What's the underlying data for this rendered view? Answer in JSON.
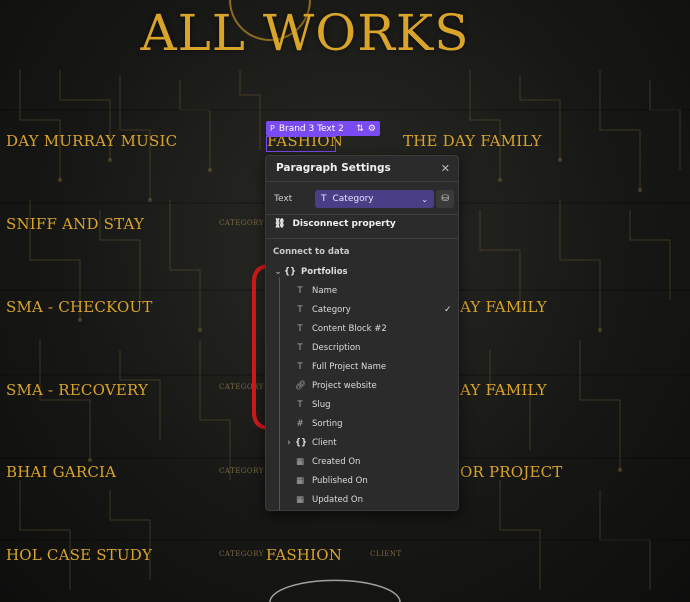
{
  "page": {
    "title": "All Works"
  },
  "works": [
    {
      "name": "Day Murray Music"
    },
    {
      "name": "Sniff and Stay"
    },
    {
      "name": "SMA - Checkout"
    },
    {
      "name": "SMA - Recovery"
    },
    {
      "name": "Bhai Garcia"
    },
    {
      "name": "HOL Case Study"
    }
  ],
  "col2": {
    "row1": "Fashion",
    "row6": "Fashion"
  },
  "col3": {
    "row1": "The Day Family",
    "row3": "ay Family",
    "row4": "ay Family",
    "row5": "or Project"
  },
  "tiny_labels": {
    "category": "CATEGORY",
    "client": "CLIENT"
  },
  "selection": {
    "type_badge": "P",
    "label": "Brand 3 Text 2"
  },
  "panel": {
    "title": "Paragraph Settings",
    "text_label": "Text",
    "binding_value": "Category",
    "disconnect_label": "Disconnect property",
    "section_label": "Connect to data",
    "tree": [
      {
        "label": "Portfolios",
        "icon": "braces-icon",
        "kind": "group"
      },
      {
        "label": "Name",
        "icon": "text-type-icon"
      },
      {
        "label": "Category",
        "icon": "text-type-icon",
        "checked": true
      },
      {
        "label": "Content Block #2",
        "icon": "text-type-icon"
      },
      {
        "label": "Description",
        "icon": "text-type-icon"
      },
      {
        "label": "Full Project Name",
        "icon": "text-type-icon"
      },
      {
        "label": "Project website",
        "icon": "link-icon"
      },
      {
        "label": "Slug",
        "icon": "text-type-icon"
      },
      {
        "label": "Sorting",
        "icon": "hash-icon"
      },
      {
        "label": "Client",
        "icon": "braces-icon",
        "kind": "group"
      },
      {
        "label": "Created On",
        "icon": "calendar-icon"
      },
      {
        "label": "Published On",
        "icon": "calendar-icon"
      },
      {
        "label": "Updated On",
        "icon": "calendar-icon"
      }
    ]
  },
  "colors": {
    "gold": "#d9a42a",
    "selection_purple": "#7a4bf0",
    "panel_bg": "#2b2b2b",
    "annotation_red": "#d11a1a"
  }
}
